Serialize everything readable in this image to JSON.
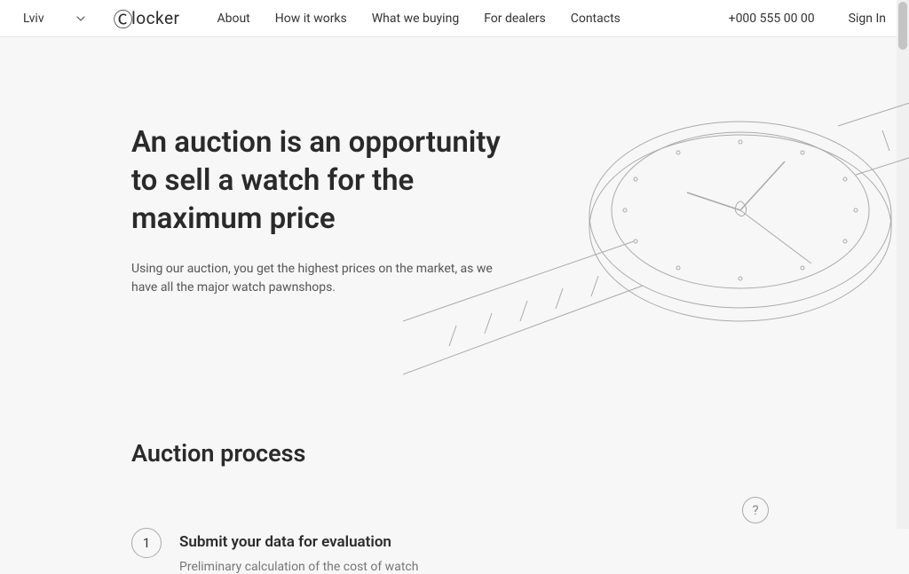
{
  "header": {
    "location": "Lviv",
    "logo": "locker",
    "nav": [
      {
        "label": "About"
      },
      {
        "label": "How it works"
      },
      {
        "label": "What we buying"
      },
      {
        "label": "For dealers"
      },
      {
        "label": "Contacts"
      }
    ],
    "phone": "+000 555 00 00",
    "signIn": "Sign In"
  },
  "hero": {
    "title": "An auction is an opportunity to sell a watch for the maximum price",
    "subtitle": "Using our auction, you get the highest prices on the market, as we have all the major watch pawnshops."
  },
  "process": {
    "title": "Auction process",
    "steps": [
      {
        "number": "1",
        "title": "Submit your data for evaluation",
        "desc": "Preliminary calculation of the cost of watch"
      }
    ]
  },
  "help": "?"
}
